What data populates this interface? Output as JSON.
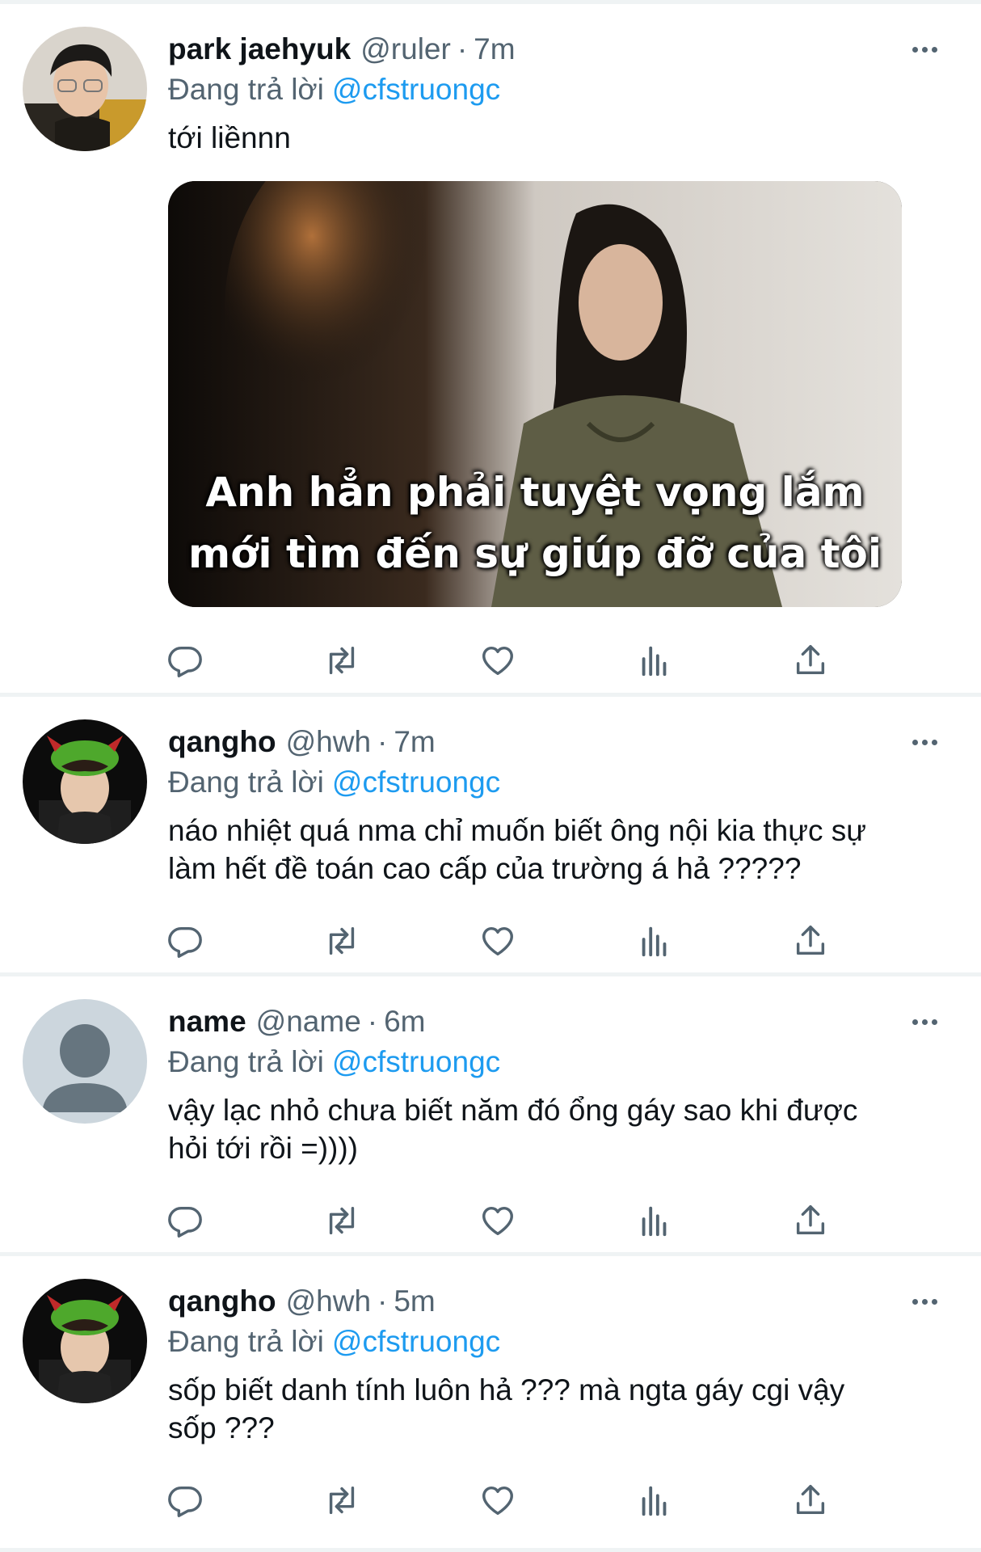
{
  "tweets": [
    {
      "name": "park jaehyuk",
      "handle": "@ruler",
      "dot": "·",
      "time": "7m",
      "reply_prefix": "Đang trả lời",
      "reply_to": "@cfstruongc",
      "text": "tới liềnnn",
      "avatar": "photo",
      "media": {
        "caption_line1": "Anh hẳn phải tuyệt vọng lắm",
        "caption_line2": "mới tìm đến sự giúp đỡ của tôi"
      }
    },
    {
      "name": "qangho",
      "handle": "@hwh",
      "dot": "·",
      "time": "7m",
      "reply_prefix": "Đang trả lời",
      "reply_to": "@cfstruongc",
      "text_line1": "náo nhiệt quá nma chỉ muốn biết ông nội kia thực sự",
      "text_line2": "làm hết đề toán cao cấp của trường á hả ?????",
      "avatar": "photo"
    },
    {
      "name": "name",
      "handle": "@name",
      "dot": "·",
      "time": "6m",
      "reply_prefix": "Đang trả lời",
      "reply_to": "@cfstruongc",
      "text_line1": "vậy lạc nhỏ chưa biết năm đó ổng gáy sao khi được",
      "text_line2": "hỏi tới rồi =))))",
      "avatar": "default-profile"
    },
    {
      "name": "qangho",
      "handle": "@hwh",
      "dot": "·",
      "time": "5m",
      "reply_prefix": "Đang trả lời",
      "reply_to": "@cfstruongc",
      "text_line1": "sốp biết danh tính luôn hả ??? mà ngta gáy cgi vậy",
      "text_line2": "sốp ???",
      "avatar": "photo"
    }
  ],
  "action_icons": [
    "reply-icon",
    "retweet-icon",
    "like-icon",
    "analytics-icon",
    "share-icon"
  ],
  "colors": {
    "text": "#0f1419",
    "secondary": "#536471",
    "link": "#1d9bf0",
    "separator": "#eff3f4"
  }
}
